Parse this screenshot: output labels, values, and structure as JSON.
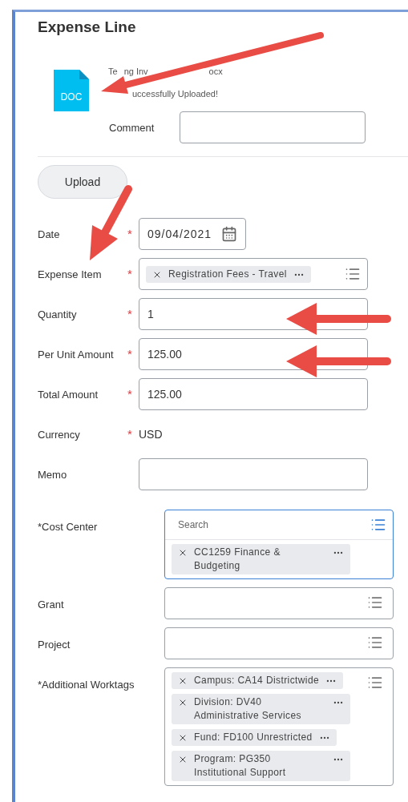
{
  "title": "Expense Line",
  "attachment": {
    "file_type": "DOC",
    "file_name_parts": [
      "Te",
      "ng Inv",
      "ocx"
    ],
    "status": "uccessfully Uploaded!",
    "comment_label": "Comment"
  },
  "upload_button": "Upload",
  "fields": [
    {
      "label": "Date",
      "required_mark": "*",
      "kind": "date",
      "value": "09/04/2021"
    },
    {
      "label": "Expense Item",
      "required_mark": "*",
      "kind": "tags",
      "tags": [
        "Registration Fees - Travel"
      ]
    },
    {
      "label": "Quantity",
      "required_mark": "*",
      "kind": "text",
      "value": "1"
    },
    {
      "label": "Per Unit Amount",
      "required_mark": "*",
      "kind": "text",
      "value": "125.00"
    },
    {
      "label": "Total Amount",
      "required_mark": "*",
      "kind": "text",
      "value": "125.00"
    },
    {
      "label": "Currency",
      "required_mark": "*",
      "kind": "readonly",
      "value": "USD"
    },
    {
      "label": "Memo",
      "kind": "text"
    }
  ],
  "worktag_fields": [
    {
      "label": "*Cost Center",
      "focused": true,
      "placeholder": "Search",
      "tags": [
        "CC1259 Finance & Budgeting"
      ]
    },
    {
      "label": "Grant",
      "focused": false
    },
    {
      "label": "Project",
      "focused": false
    },
    {
      "label": "*Additional Worktags",
      "focused": false,
      "tags": [
        "Campus: CA14 Districtwide",
        "Division: DV40 Administrative Services",
        "Fund: FD100 Unrestricted",
        "Program: PG350 Institutional Support"
      ]
    }
  ]
}
